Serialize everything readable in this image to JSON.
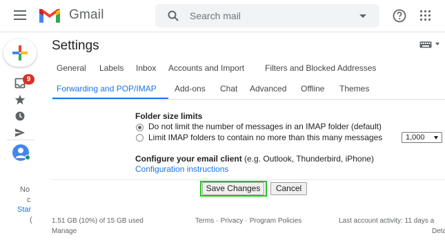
{
  "header": {
    "app_name": "Gmail",
    "search_placeholder": "Search mail"
  },
  "left_rail": {
    "inbox_badge": "9",
    "hangouts_lines": [
      "No",
      "c",
      "Star",
      "("
    ]
  },
  "settings": {
    "title": "Settings",
    "tabs_row1": [
      "General",
      "Labels",
      "Inbox",
      "Accounts and Import",
      "Filters and Blocked Addresses"
    ],
    "tabs_row2": [
      "Forwarding and POP/IMAP",
      "Add-ons",
      "Chat",
      "Advanced",
      "Offline",
      "Themes"
    ],
    "active_tab": "Forwarding and POP/IMAP"
  },
  "folder_size": {
    "heading": "Folder size limits",
    "option1": "Do not limit the number of messages in an IMAP folder (default)",
    "option2": "Limit IMAP folders to contain no more than this many messages",
    "selected_option": 1,
    "limit_value": "1,000"
  },
  "email_client": {
    "heading": "Configure your email client",
    "examples": "(e.g. Outlook, Thunderbird, iPhone)",
    "link": "Configuration instructions"
  },
  "buttons": {
    "save": "Save Changes",
    "cancel": "Cancel"
  },
  "footer": {
    "storage": "1.51 GB (10%) of 15 GB used",
    "manage": "Manage",
    "terms": "Terms",
    "privacy": "Privacy",
    "policies": "Program Policies",
    "separator": "·",
    "activity": "Last account activity: 11 days a",
    "details": "Deta"
  },
  "colors": {
    "accent": "#1a73e8",
    "badge": "#d93025",
    "highlight": "#22c41a"
  }
}
